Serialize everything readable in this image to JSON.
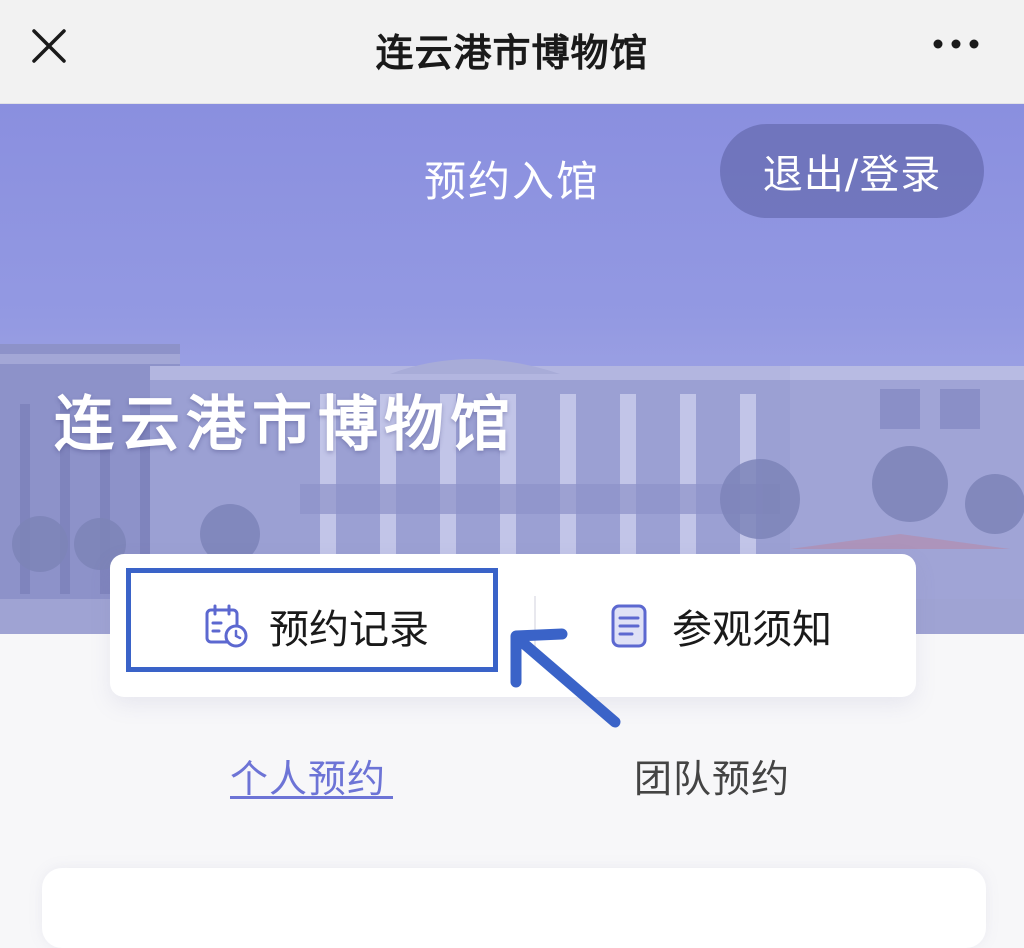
{
  "nav": {
    "title": "连云港市博物馆",
    "close_icon": "close-icon",
    "more_icon": "more-dots-icon"
  },
  "hero": {
    "title": "预约入馆",
    "login_button": "退出/登录",
    "museum_name": "连云港市博物馆"
  },
  "actions": {
    "records_label": "预约记录",
    "records_icon": "calendar-clock-icon",
    "notice_label": "参观须知",
    "notice_icon": "document-icon"
  },
  "tabs": {
    "personal": "个人预约",
    "team": "团队预约",
    "active": "personal"
  },
  "colors": {
    "accent": "#6d74d6",
    "highlight": "#3a63c8",
    "hero": "#9399e2"
  }
}
